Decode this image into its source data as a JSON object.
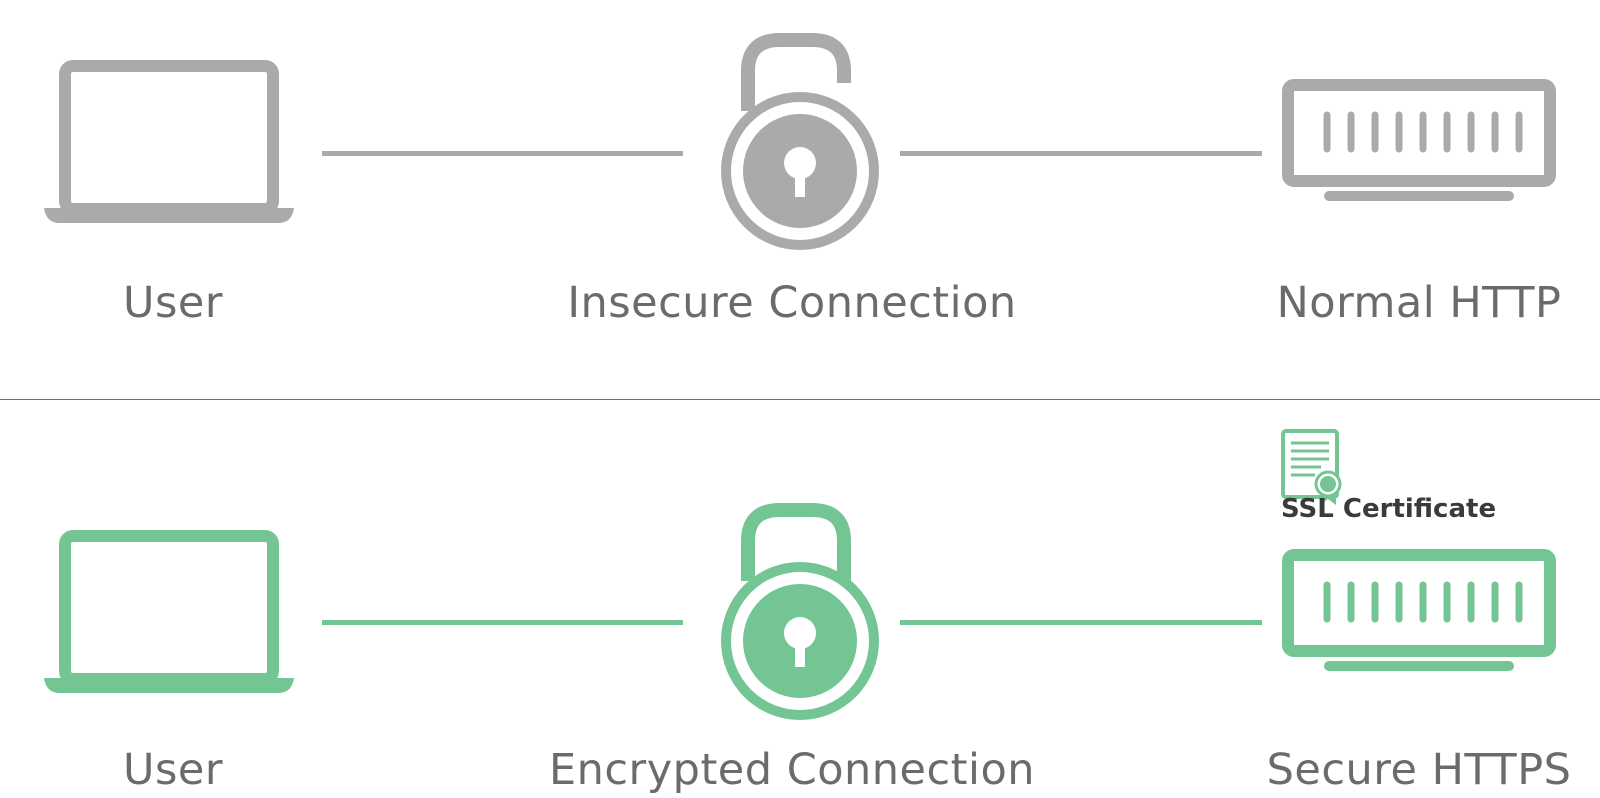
{
  "colors": {
    "insecure": "#aaaaaa",
    "secure": "#74c594",
    "divider": "#707070",
    "text": "#6b6b6b",
    "cert_text": "#3a3a3a"
  },
  "insecure": {
    "user_label": "User",
    "connection_label": "Insecure Connection",
    "server_label": "Normal HTTP",
    "icons": [
      "laptop-icon",
      "unlocked-padlock-icon",
      "server-icon"
    ]
  },
  "secure": {
    "user_label": "User",
    "connection_label": "Encrypted Connection",
    "server_label": "Secure HTTPS",
    "certificate_label": "SSL Certificate",
    "icons": [
      "laptop-icon",
      "locked-padlock-icon",
      "server-icon",
      "certificate-icon"
    ]
  }
}
